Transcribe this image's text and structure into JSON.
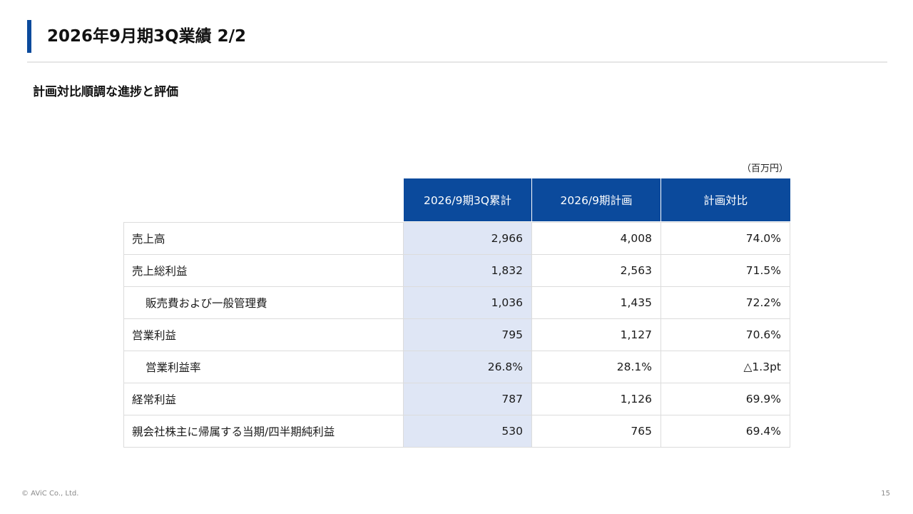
{
  "slide": {
    "title": "2026年9月期3Q業績 2/2",
    "subtitle": "計画対比順調な進捗と評価",
    "unit_note": "（百万円）",
    "footer": "© AViC Co., Ltd.",
    "page_number": "15",
    "accent_color": "#0b4a9c"
  },
  "table": {
    "headers": [
      "2026/9期3Q累計",
      "2026/9期計画",
      "計画対比"
    ],
    "rows": [
      {
        "label": "売上高",
        "values": [
          "2,966",
          "4,008",
          "74.0%"
        ]
      },
      {
        "label": "売上総利益",
        "values": [
          "1,832",
          "2,563",
          "71.5%"
        ]
      },
      {
        "label": "販売費および一般管理費",
        "values": [
          "1,036",
          "1,435",
          "72.2%"
        ]
      },
      {
        "label": "営業利益",
        "values": [
          "795",
          "1,127",
          "70.6%"
        ]
      },
      {
        "label": "営業利益率",
        "values": [
          "26.8%",
          "28.1%",
          "△1.3pt"
        ]
      },
      {
        "label": "経常利益",
        "values": [
          "787",
          "1,126",
          "69.9%"
        ]
      },
      {
        "label": "親会社株主に帰属する当期/四半期純利益",
        "values": [
          "530",
          "765",
          "69.4%"
        ]
      }
    ]
  }
}
